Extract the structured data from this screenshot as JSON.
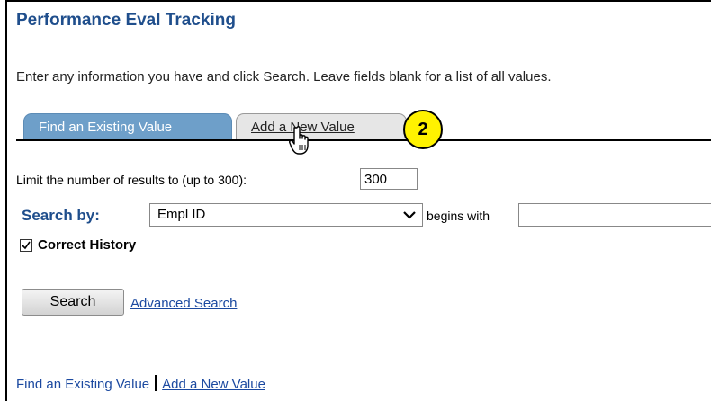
{
  "page": {
    "title": "Performance Eval Tracking",
    "instructions": "Enter any information you have and click Search. Leave fields blank for a list of all values."
  },
  "tabs": [
    {
      "label": "Find an Existing Value",
      "active": true
    },
    {
      "label": "Add a New Value",
      "active": false
    }
  ],
  "callout": {
    "number": "2",
    "color": "#fff200"
  },
  "form": {
    "limit_label": "Limit the number of results to (up to 300):",
    "limit_value": "300",
    "search_by_label": "Search by:",
    "search_by_selected": "Empl ID",
    "operator_label": "begins with",
    "search_value": "",
    "correct_history_label": "Correct History",
    "correct_history_checked": true
  },
  "actions": {
    "search_label": "Search",
    "advanced_search_label": "Advanced Search"
  },
  "footer_links": {
    "find_existing": "Find an Existing Value",
    "add_new": "Add a New Value"
  },
  "colors": {
    "title": "#1f4e8c",
    "active_tab": "#6e9fc9",
    "inactive_tab": "#e6e6e6",
    "link": "#1b49a0"
  },
  "icons": {
    "cursor": "hand-pointer-icon",
    "dropdown": "chevron-down-icon",
    "check": "checkmark-icon"
  }
}
